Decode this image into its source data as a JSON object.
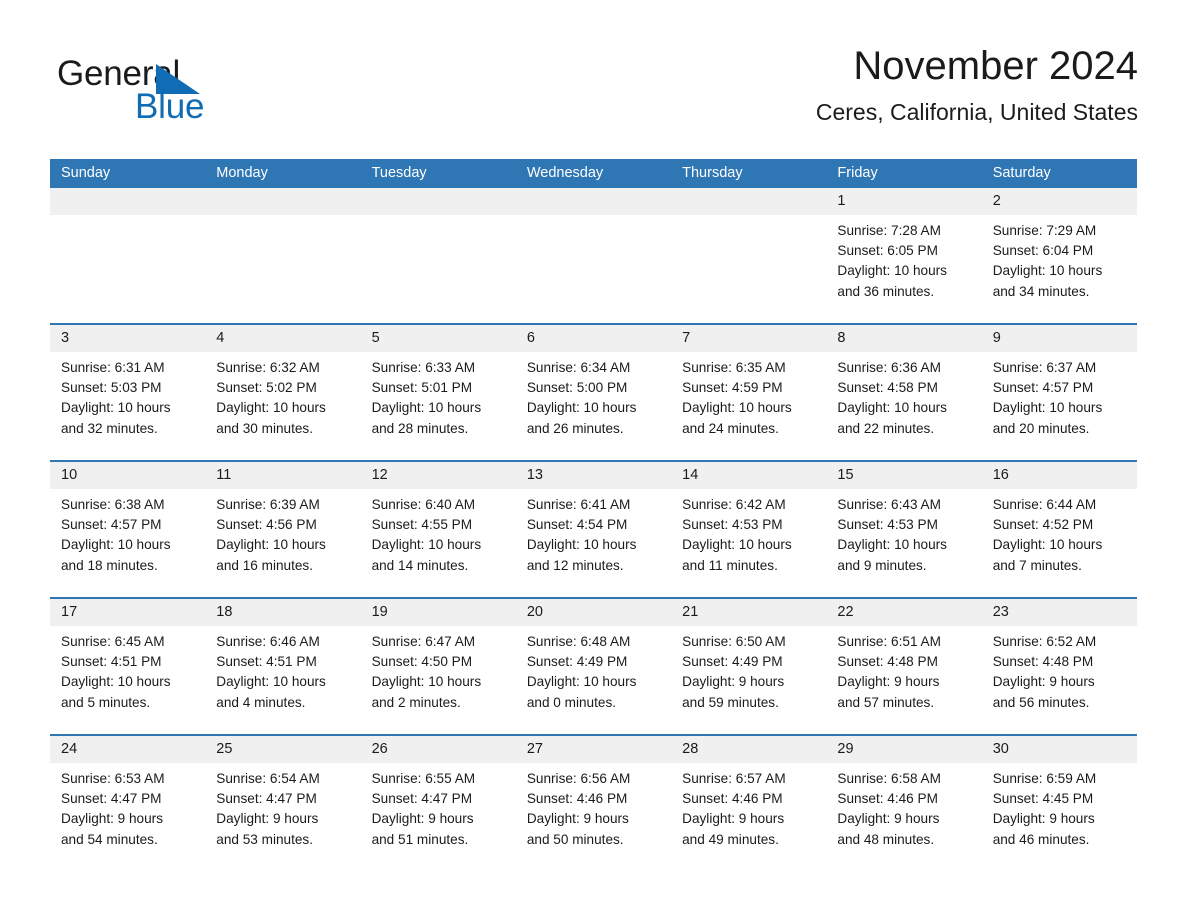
{
  "brand": {
    "name_part1": "General",
    "name_part2": "Blue",
    "accent_color": "#0f6cb5"
  },
  "header": {
    "title": "November 2024",
    "subtitle": "Ceres, California, United States"
  },
  "theme": {
    "header_blue": "#2f76b4",
    "date_band_gray": "#f0f0f0",
    "text_color": "#1b1b1b"
  },
  "weekdays": [
    "Sunday",
    "Monday",
    "Tuesday",
    "Wednesday",
    "Thursday",
    "Friday",
    "Saturday"
  ],
  "weeks": [
    {
      "days": [
        {
          "num": "",
          "lines": [
            "",
            "",
            "",
            ""
          ]
        },
        {
          "num": "",
          "lines": [
            "",
            "",
            "",
            ""
          ]
        },
        {
          "num": "",
          "lines": [
            "",
            "",
            "",
            ""
          ]
        },
        {
          "num": "",
          "lines": [
            "",
            "",
            "",
            ""
          ]
        },
        {
          "num": "",
          "lines": [
            "",
            "",
            "",
            ""
          ]
        },
        {
          "num": "1",
          "lines": [
            "Sunrise: 7:28 AM",
            "Sunset: 6:05 PM",
            "Daylight: 10 hours",
            "and 36 minutes."
          ]
        },
        {
          "num": "2",
          "lines": [
            "Sunrise: 7:29 AM",
            "Sunset: 6:04 PM",
            "Daylight: 10 hours",
            "and 34 minutes."
          ]
        }
      ]
    },
    {
      "days": [
        {
          "num": "3",
          "lines": [
            "Sunrise: 6:31 AM",
            "Sunset: 5:03 PM",
            "Daylight: 10 hours",
            "and 32 minutes."
          ]
        },
        {
          "num": "4",
          "lines": [
            "Sunrise: 6:32 AM",
            "Sunset: 5:02 PM",
            "Daylight: 10 hours",
            "and 30 minutes."
          ]
        },
        {
          "num": "5",
          "lines": [
            "Sunrise: 6:33 AM",
            "Sunset: 5:01 PM",
            "Daylight: 10 hours",
            "and 28 minutes."
          ]
        },
        {
          "num": "6",
          "lines": [
            "Sunrise: 6:34 AM",
            "Sunset: 5:00 PM",
            "Daylight: 10 hours",
            "and 26 minutes."
          ]
        },
        {
          "num": "7",
          "lines": [
            "Sunrise: 6:35 AM",
            "Sunset: 4:59 PM",
            "Daylight: 10 hours",
            "and 24 minutes."
          ]
        },
        {
          "num": "8",
          "lines": [
            "Sunrise: 6:36 AM",
            "Sunset: 4:58 PM",
            "Daylight: 10 hours",
            "and 22 minutes."
          ]
        },
        {
          "num": "9",
          "lines": [
            "Sunrise: 6:37 AM",
            "Sunset: 4:57 PM",
            "Daylight: 10 hours",
            "and 20 minutes."
          ]
        }
      ]
    },
    {
      "days": [
        {
          "num": "10",
          "lines": [
            "Sunrise: 6:38 AM",
            "Sunset: 4:57 PM",
            "Daylight: 10 hours",
            "and 18 minutes."
          ]
        },
        {
          "num": "11",
          "lines": [
            "Sunrise: 6:39 AM",
            "Sunset: 4:56 PM",
            "Daylight: 10 hours",
            "and 16 minutes."
          ]
        },
        {
          "num": "12",
          "lines": [
            "Sunrise: 6:40 AM",
            "Sunset: 4:55 PM",
            "Daylight: 10 hours",
            "and 14 minutes."
          ]
        },
        {
          "num": "13",
          "lines": [
            "Sunrise: 6:41 AM",
            "Sunset: 4:54 PM",
            "Daylight: 10 hours",
            "and 12 minutes."
          ]
        },
        {
          "num": "14",
          "lines": [
            "Sunrise: 6:42 AM",
            "Sunset: 4:53 PM",
            "Daylight: 10 hours",
            "and 11 minutes."
          ]
        },
        {
          "num": "15",
          "lines": [
            "Sunrise: 6:43 AM",
            "Sunset: 4:53 PM",
            "Daylight: 10 hours",
            "and 9 minutes."
          ]
        },
        {
          "num": "16",
          "lines": [
            "Sunrise: 6:44 AM",
            "Sunset: 4:52 PM",
            "Daylight: 10 hours",
            "and 7 minutes."
          ]
        }
      ]
    },
    {
      "days": [
        {
          "num": "17",
          "lines": [
            "Sunrise: 6:45 AM",
            "Sunset: 4:51 PM",
            "Daylight: 10 hours",
            "and 5 minutes."
          ]
        },
        {
          "num": "18",
          "lines": [
            "Sunrise: 6:46 AM",
            "Sunset: 4:51 PM",
            "Daylight: 10 hours",
            "and 4 minutes."
          ]
        },
        {
          "num": "19",
          "lines": [
            "Sunrise: 6:47 AM",
            "Sunset: 4:50 PM",
            "Daylight: 10 hours",
            "and 2 minutes."
          ]
        },
        {
          "num": "20",
          "lines": [
            "Sunrise: 6:48 AM",
            "Sunset: 4:49 PM",
            "Daylight: 10 hours",
            "and 0 minutes."
          ]
        },
        {
          "num": "21",
          "lines": [
            "Sunrise: 6:50 AM",
            "Sunset: 4:49 PM",
            "Daylight: 9 hours",
            "and 59 minutes."
          ]
        },
        {
          "num": "22",
          "lines": [
            "Sunrise: 6:51 AM",
            "Sunset: 4:48 PM",
            "Daylight: 9 hours",
            "and 57 minutes."
          ]
        },
        {
          "num": "23",
          "lines": [
            "Sunrise: 6:52 AM",
            "Sunset: 4:48 PM",
            "Daylight: 9 hours",
            "and 56 minutes."
          ]
        }
      ]
    },
    {
      "days": [
        {
          "num": "24",
          "lines": [
            "Sunrise: 6:53 AM",
            "Sunset: 4:47 PM",
            "Daylight: 9 hours",
            "and 54 minutes."
          ]
        },
        {
          "num": "25",
          "lines": [
            "Sunrise: 6:54 AM",
            "Sunset: 4:47 PM",
            "Daylight: 9 hours",
            "and 53 minutes."
          ]
        },
        {
          "num": "26",
          "lines": [
            "Sunrise: 6:55 AM",
            "Sunset: 4:47 PM",
            "Daylight: 9 hours",
            "and 51 minutes."
          ]
        },
        {
          "num": "27",
          "lines": [
            "Sunrise: 6:56 AM",
            "Sunset: 4:46 PM",
            "Daylight: 9 hours",
            "and 50 minutes."
          ]
        },
        {
          "num": "28",
          "lines": [
            "Sunrise: 6:57 AM",
            "Sunset: 4:46 PM",
            "Daylight: 9 hours",
            "and 49 minutes."
          ]
        },
        {
          "num": "29",
          "lines": [
            "Sunrise: 6:58 AM",
            "Sunset: 4:46 PM",
            "Daylight: 9 hours",
            "and 48 minutes."
          ]
        },
        {
          "num": "30",
          "lines": [
            "Sunrise: 6:59 AM",
            "Sunset: 4:45 PM",
            "Daylight: 9 hours",
            "and 46 minutes."
          ]
        }
      ]
    }
  ]
}
